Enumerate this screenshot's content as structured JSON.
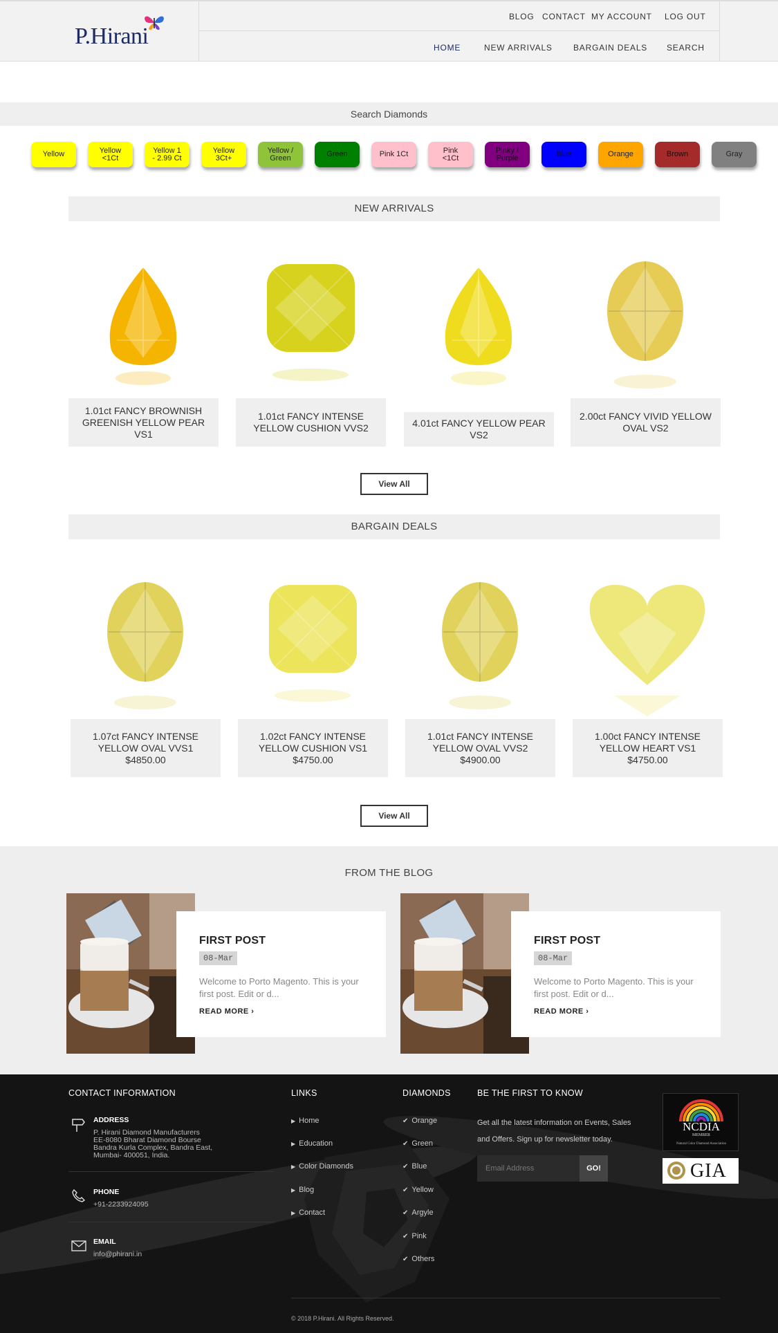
{
  "brand": {
    "name": "P.Hirani"
  },
  "header": {
    "top_links": [
      "BLOG",
      "CONTACT",
      "MY ACCOUNT",
      "LOG OUT"
    ],
    "main_links": [
      "HOME",
      "NEW ARRIVALS",
      "BARGAIN DEALS",
      "SEARCH"
    ],
    "active": "HOME"
  },
  "search": {
    "title": "Search Diamonds",
    "colors": [
      {
        "label": "Yellow",
        "color": "#ffff00"
      },
      {
        "label": "Yellow\n<1Ct",
        "color": "#ffff00"
      },
      {
        "label": "Yellow 1\n- 2.99 Ct",
        "color": "#ffff00"
      },
      {
        "label": "Yellow\n3Ct+",
        "color": "#ffff00"
      },
      {
        "label": "Yellow /\nGreen",
        "color": "#8fc43a"
      },
      {
        "label": "Green",
        "color": "#008000"
      },
      {
        "label": "Pink 1Ct",
        "color": "#ffc0cb"
      },
      {
        "label": "Pink\n<1Ct",
        "color": "#ffc0cb"
      },
      {
        "label": "Pinky /\nPurple",
        "color": "#800080"
      },
      {
        "label": "Blue",
        "color": "#0000ff"
      },
      {
        "label": "Orange",
        "color": "#ffa500"
      },
      {
        "label": "Brown",
        "color": "#a52a2a"
      },
      {
        "label": "Gray",
        "color": "#808080"
      }
    ]
  },
  "new_arrivals": {
    "title": "NEW ARRIVALS",
    "view_all": "View All",
    "items": [
      {
        "name": "1.01ct FANCY BROWNISH GREENISH YELLOW PEAR VS1",
        "shape": "pear-icon",
        "color": "#f5b400"
      },
      {
        "name": "1.01ct FANCY INTENSE YELLOW CUSHION VVS2",
        "shape": "cushion-icon",
        "color": "#d7d21e"
      },
      {
        "name": "4.01ct FANCY YELLOW PEAR VS2",
        "shape": "pear-icon",
        "color": "#f0dc1e"
      },
      {
        "name": "2.00ct FANCY VIVID YELLOW OVAL VS2",
        "shape": "oval-icon",
        "color": "#e6cc55"
      }
    ]
  },
  "bargain_deals": {
    "title": "BARGAIN DEALS",
    "view_all": "View All",
    "items": [
      {
        "name": "1.07ct FANCY INTENSE YELLOW OVAL VVS1",
        "price": "$4850.00",
        "shape": "oval-icon",
        "color": "#e0d25a"
      },
      {
        "name": "1.02ct FANCY INTENSE YELLOW CUSHION VS1",
        "price": "$4750.00",
        "shape": "cushion-icon",
        "color": "#ece45a"
      },
      {
        "name": "1.01ct FANCY INTENSE YELLOW OVAL VVS2",
        "price": "$4900.00",
        "shape": "oval-icon",
        "color": "#e0d25a"
      },
      {
        "name": "1.00ct FANCY INTENSE YELLOW HEART VS1",
        "price": "$4750.00",
        "shape": "heart-icon",
        "color": "#eee77a"
      }
    ]
  },
  "blog": {
    "title": "FROM THE BLOG",
    "posts": [
      {
        "title": "FIRST POST",
        "date": "08-Mar",
        "excerpt": "Welcome to Porto Magento. This is your first post. Edit or d...",
        "read_more": "READ MORE"
      },
      {
        "title": "FIRST POST",
        "date": "08-Mar",
        "excerpt": "Welcome to Porto Magento. This is your first post. Edit or d...",
        "read_more": "READ MORE"
      }
    ]
  },
  "footer": {
    "contact": {
      "title": "CONTACT INFORMATION",
      "address_label": "ADDRESS",
      "address_lines": [
        "P. Hirani Diamond Manufacturers",
        "EE-8080 Bharat Diamond Bourse",
        "Bandra Kurla Complex, Bandra East,",
        "Mumbai- 400051, India."
      ],
      "phone_label": "PHONE",
      "phone": "+91-2233924095",
      "email_label": "EMAIL",
      "email": "info@phirani.in"
    },
    "links": {
      "title": "LINKS",
      "items": [
        "Home",
        "Education",
        "Color Diamonds",
        "Blog",
        "Contact"
      ]
    },
    "diamonds": {
      "title": "DIAMONDS",
      "items": [
        "Orange",
        "Green",
        "Blue",
        "Yellow",
        "Argyle",
        "Pink",
        "Others"
      ]
    },
    "newsletter": {
      "title": "BE THE FIRST TO KNOW",
      "text": "Get all the latest information on Events, Sales and Offers. Sign up for newsletter today.",
      "placeholder": "Email Address",
      "button": "GO!"
    },
    "badges": {
      "ncdia": "NCDIA",
      "ncdia_member": "MEMBER",
      "ncdia_sub": "Natural Color Diamond Association",
      "gia": "GIA"
    },
    "copyright": "© 2018 P.Hirani. All Rights Reserved."
  }
}
